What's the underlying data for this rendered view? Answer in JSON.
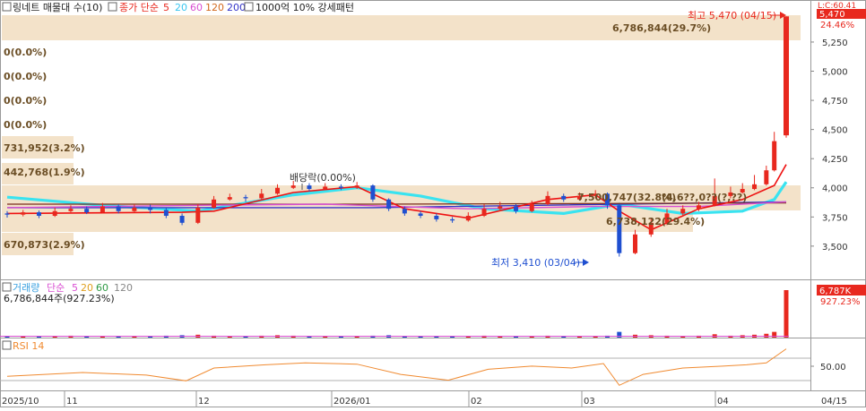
{
  "header": {
    "stock_label": "링네트 매물대 수(10)",
    "ma_label": "종가 단순",
    "ma_periods": [
      "5",
      "20",
      "60",
      "120",
      "200"
    ],
    "pattern_label": "1000억 10% 강세패턴",
    "price_corner_label": "L:C:60.41"
  },
  "volume_profile": {
    "labels": [
      "6,786,844(29.7%)",
      "0(0.0%)",
      "0(0.0%)",
      "0(0.0%)",
      "0(0.0%)",
      "731,952(3.2%)",
      "442,768(1.9%)",
      "670,873(2.9%)"
    ],
    "mid_labels": [
      "7,500,747(32.8%)",
      "6,738,122(29.4%)"
    ],
    "overlap_label": "(4,6??,0??(?,??)"
  },
  "annotations": {
    "high": "최고 5,470 (04/15)",
    "low": "최저 3,410 (03/04)",
    "dividend": "배당락(0.00%)"
  },
  "price_axis": {
    "ticks": [
      "5,250",
      "5,000",
      "4,750",
      "4,500",
      "4,250",
      "4,000",
      "3,750",
      "3,500"
    ],
    "current_value": "5,470",
    "current_pct": "24.46%"
  },
  "volume_panel": {
    "legend_title": "거래량",
    "legend_ma_label": "단순",
    "legend_periods": [
      "5",
      "20",
      "60",
      "120"
    ],
    "value_text": "6,786,844주(927.23%)",
    "current_value": "6,787K",
    "current_pct": "927.23%"
  },
  "rsi_panel": {
    "label": "RSI 14",
    "tick": "50.00"
  },
  "x_axis": {
    "labels": [
      "2025/10",
      "11",
      "12",
      "2026/01",
      "02",
      "03",
      "04",
      "04/15"
    ]
  },
  "colors": {
    "up": "#e8281e",
    "down": "#1f4fd0",
    "ma5": "#ee1111",
    "ma20": "#39e3f0",
    "ma60": "#d94fd2",
    "ma120": "#7b2e1e",
    "ma200": "#3434c8",
    "profile_band": "#f3e2c9",
    "rsi": "#f08a30"
  },
  "chart_data": {
    "type": "candlestick",
    "x_start": "2025-10-01",
    "x_end": "2026-04-15",
    "ylim": [
      3330,
      5480
    ],
    "candles": [
      {
        "date": "2025-10-01",
        "open": 3780,
        "close": 3770,
        "high": 3800,
        "low": 3745
      },
      {
        "date": "2025-10-05",
        "open": 3770,
        "close": 3790,
        "high": 3810,
        "low": 3755
      },
      {
        "date": "2025-10-09",
        "open": 3790,
        "close": 3760,
        "high": 3805,
        "low": 3740
      },
      {
        "date": "2025-10-13",
        "open": 3760,
        "close": 3800,
        "high": 3830,
        "low": 3750
      },
      {
        "date": "2025-10-17",
        "open": 3800,
        "close": 3820,
        "high": 3850,
        "low": 3790
      },
      {
        "date": "2025-10-21",
        "open": 3820,
        "close": 3790,
        "high": 3840,
        "low": 3775
      },
      {
        "date": "2025-10-25",
        "open": 3790,
        "close": 3840,
        "high": 3870,
        "low": 3780
      },
      {
        "date": "2025-10-29",
        "open": 3840,
        "close": 3800,
        "high": 3860,
        "low": 3780
      },
      {
        "date": "2025-11-02",
        "open": 3800,
        "close": 3830,
        "high": 3860,
        "low": 3790
      },
      {
        "date": "2025-11-06",
        "open": 3830,
        "close": 3810,
        "high": 3855,
        "low": 3780
      },
      {
        "date": "2025-11-10",
        "open": 3810,
        "close": 3760,
        "high": 3830,
        "low": 3740
      },
      {
        "date": "2025-11-14",
        "open": 3760,
        "close": 3700,
        "high": 3780,
        "low": 3680
      },
      {
        "date": "2025-11-18",
        "open": 3700,
        "close": 3830,
        "high": 3860,
        "low": 3690
      },
      {
        "date": "2025-11-22",
        "open": 3830,
        "close": 3900,
        "high": 3930,
        "low": 3820
      },
      {
        "date": "2025-11-26",
        "open": 3900,
        "close": 3920,
        "high": 3950,
        "low": 3890
      },
      {
        "date": "2025-11-30",
        "open": 3920,
        "close": 3910,
        "high": 3940,
        "low": 3880
      },
      {
        "date": "2025-12-04",
        "open": 3910,
        "close": 3950,
        "high": 3990,
        "low": 3900
      },
      {
        "date": "2025-12-08",
        "open": 3950,
        "close": 4000,
        "high": 4030,
        "low": 3940
      },
      {
        "date": "2025-12-12",
        "open": 4000,
        "close": 4020,
        "high": 4060,
        "low": 3990
      },
      {
        "date": "2025-12-16",
        "open": 4020,
        "close": 3990,
        "high": 4040,
        "low": 3970
      },
      {
        "date": "2025-12-20",
        "open": 3990,
        "close": 4010,
        "high": 4040,
        "low": 3980
      },
      {
        "date": "2025-12-24",
        "open": 4010,
        "close": 4000,
        "high": 4030,
        "low": 3980
      },
      {
        "date": "2025-12-28",
        "open": 4000,
        "close": 4020,
        "high": 4050,
        "low": 3990
      },
      {
        "date": "2026-01-01",
        "open": 4020,
        "close": 3900,
        "high": 4030,
        "low": 3880
      },
      {
        "date": "2026-01-05",
        "open": 3900,
        "close": 3820,
        "high": 3910,
        "low": 3800
      },
      {
        "date": "2026-01-09",
        "open": 3820,
        "close": 3780,
        "high": 3840,
        "low": 3760
      },
      {
        "date": "2026-01-13",
        "open": 3780,
        "close": 3760,
        "high": 3800,
        "low": 3740
      },
      {
        "date": "2026-01-17",
        "open": 3760,
        "close": 3730,
        "high": 3780,
        "low": 3710
      },
      {
        "date": "2026-01-21",
        "open": 3730,
        "close": 3720,
        "high": 3750,
        "low": 3700
      },
      {
        "date": "2026-01-25",
        "open": 3720,
        "close": 3760,
        "high": 3790,
        "low": 3710
      },
      {
        "date": "2026-01-29",
        "open": 3760,
        "close": 3820,
        "high": 3860,
        "low": 3750
      },
      {
        "date": "2026-02-02",
        "open": 3820,
        "close": 3840,
        "high": 3880,
        "low": 3800
      },
      {
        "date": "2026-02-06",
        "open": 3840,
        "close": 3800,
        "high": 3860,
        "low": 3780
      },
      {
        "date": "2026-02-10",
        "open": 3800,
        "close": 3860,
        "high": 3890,
        "low": 3790
      },
      {
        "date": "2026-02-14",
        "open": 3860,
        "close": 3930,
        "high": 3970,
        "low": 3850
      },
      {
        "date": "2026-02-18",
        "open": 3930,
        "close": 3900,
        "high": 3950,
        "low": 3880
      },
      {
        "date": "2026-02-22",
        "open": 3900,
        "close": 3930,
        "high": 3960,
        "low": 3890
      },
      {
        "date": "2026-02-26",
        "open": 3930,
        "close": 3950,
        "high": 3980,
        "low": 3910
      },
      {
        "date": "2026-03-01",
        "open": 3950,
        "close": 3850,
        "high": 3960,
        "low": 3820
      },
      {
        "date": "2026-03-04",
        "open": 3850,
        "close": 3440,
        "high": 3860,
        "low": 3410
      },
      {
        "date": "2026-03-08",
        "open": 3440,
        "close": 3600,
        "high": 3640,
        "low": 3430
      },
      {
        "date": "2026-03-12",
        "open": 3600,
        "close": 3700,
        "high": 3740,
        "low": 3580
      },
      {
        "date": "2026-03-16",
        "open": 3700,
        "close": 3780,
        "high": 3820,
        "low": 3680
      },
      {
        "date": "2026-03-20",
        "open": 3780,
        "close": 3820,
        "high": 3850,
        "low": 3760
      },
      {
        "date": "2026-03-24",
        "open": 3820,
        "close": 3850,
        "high": 3880,
        "low": 3800
      },
      {
        "date": "2026-03-28",
        "open": 3850,
        "close": 3930,
        "high": 4080,
        "low": 3840
      },
      {
        "date": "2026-04-01",
        "open": 3930,
        "close": 3960,
        "high": 4010,
        "low": 3910
      },
      {
        "date": "2026-04-04",
        "open": 3960,
        "close": 3990,
        "high": 4040,
        "low": 3950
      },
      {
        "date": "2026-04-07",
        "open": 3990,
        "close": 4030,
        "high": 4110,
        "low": 3980
      },
      {
        "date": "2026-04-10",
        "open": 4030,
        "close": 4150,
        "high": 4190,
        "low": 4020
      },
      {
        "date": "2026-04-12",
        "open": 4150,
        "close": 4400,
        "high": 4480,
        "low": 4140
      },
      {
        "date": "2026-04-15",
        "open": 4450,
        "close": 5470,
        "high": 5470,
        "low": 4430
      }
    ],
    "moving_averages": [
      {
        "name": "5",
        "dates": [
          "2025-10-01",
          "2025-11-14",
          "2025-11-22",
          "2025-12-12",
          "2025-12-28",
          "2026-01-09",
          "2026-01-25",
          "2026-02-14",
          "2026-02-26",
          "2026-03-04",
          "2026-03-12",
          "2026-03-24",
          "2026-04-04",
          "2026-04-12",
          "2026-04-15"
        ],
        "values": [
          3780,
          3790,
          3800,
          3960,
          4010,
          3820,
          3740,
          3900,
          3940,
          3800,
          3640,
          3820,
          3900,
          4020,
          4200
        ]
      },
      {
        "name": "20",
        "dates": [
          "2025-10-01",
          "2025-10-25",
          "2025-11-18",
          "2025-12-12",
          "2025-12-28",
          "2026-01-13",
          "2026-01-29",
          "2026-02-18",
          "2026-03-04",
          "2026-03-20",
          "2026-04-04",
          "2026-04-12",
          "2026-04-15"
        ],
        "values": [
          3920,
          3850,
          3800,
          3940,
          4000,
          3930,
          3820,
          3780,
          3860,
          3780,
          3800,
          3900,
          4050
        ]
      },
      {
        "name": "60",
        "dates": [
          "2025-10-01",
          "2025-11-18",
          "2025-12-20",
          "2026-01-25",
          "2026-02-26",
          "2026-03-24",
          "2026-04-15"
        ],
        "values": [
          3830,
          3850,
          3860,
          3820,
          3840,
          3840,
          3880
        ]
      },
      {
        "name": "120",
        "dates": [
          "2025-10-01",
          "2026-01-01",
          "2026-04-15"
        ],
        "values": [
          3860,
          3860,
          3870
        ]
      },
      {
        "name": "200",
        "dates": [
          "2025-10-01",
          "2026-01-01",
          "2026-04-15"
        ],
        "values": [
          3830,
          3830,
          3880
        ]
      }
    ],
    "volume_rel": [
      0.03,
      0.02,
      0.03,
      0.02,
      0.04,
      0.02,
      0.03,
      0.02,
      0.03,
      0.02,
      0.04,
      0.05,
      0.06,
      0.04,
      0.03,
      0.02,
      0.04,
      0.05,
      0.04,
      0.03,
      0.02,
      0.03,
      0.03,
      0.04,
      0.05,
      0.03,
      0.02,
      0.03,
      0.02,
      0.03,
      0.04,
      0.03,
      0.02,
      0.03,
      0.04,
      0.03,
      0.02,
      0.03,
      0.04,
      0.12,
      0.06,
      0.05,
      0.04,
      0.03,
      0.04,
      0.07,
      0.04,
      0.05,
      0.06,
      0.08,
      0.12,
      1.0
    ],
    "rsi": {
      "dates": [
        "2025-10-01",
        "2025-10-20",
        "2025-11-05",
        "2025-11-15",
        "2025-11-22",
        "2025-12-05",
        "2025-12-15",
        "2025-12-28",
        "2026-01-08",
        "2026-01-20",
        "2026-01-30",
        "2026-02-10",
        "2026-02-20",
        "2026-02-28",
        "2026-03-04",
        "2026-03-10",
        "2026-03-20",
        "2026-03-30",
        "2026-04-05",
        "2026-04-10",
        "2026-04-15"
      ],
      "values": [
        42,
        48,
        44,
        35,
        55,
        60,
        63,
        61,
        45,
        36,
        53,
        58,
        55,
        62,
        28,
        45,
        55,
        58,
        60,
        63,
        85
      ]
    },
    "rsi_ylim": [
      20,
      90
    ]
  }
}
